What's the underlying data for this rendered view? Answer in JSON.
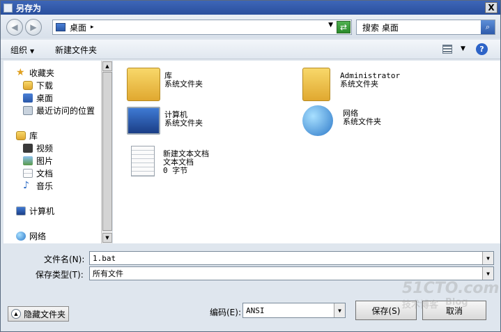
{
  "window": {
    "title": "另存为",
    "close_label": "X"
  },
  "nav": {
    "address": "桌面",
    "search_placeholder": "搜索 桌面"
  },
  "toolbar": {
    "organize": "组织",
    "new_folder": "新建文件夹",
    "help": "?"
  },
  "sidebar": {
    "favorites": "收藏夹",
    "downloads": "下载",
    "desktop": "桌面",
    "recent": "最近访问的位置",
    "libraries": "库",
    "videos": "视频",
    "pictures": "图片",
    "documents": "文档",
    "music": "音乐",
    "computer": "计算机",
    "network": "网络"
  },
  "items": [
    {
      "name": "库",
      "type": "系统文件夹"
    },
    {
      "name": "Administrator",
      "type": "系统文件夹"
    },
    {
      "name": "计算机",
      "type": "系统文件夹"
    },
    {
      "name": "网络",
      "type": "系统文件夹"
    },
    {
      "name": "新建文本文档",
      "type": "文本文档",
      "size": "0 字节"
    }
  ],
  "form": {
    "filename_label": "文件名(N):",
    "filename_value": "1.bat",
    "filetype_label": "保存类型(T):",
    "filetype_value": "所有文件",
    "encoding_label": "编码(E):",
    "encoding_value": "ANSI",
    "hide_folders": "隐藏文件夹",
    "save": "保存(S)",
    "cancel": "取消"
  },
  "watermark": {
    "site": "51CTO.com",
    "sub": "技术博客",
    "blog": "Blog"
  }
}
